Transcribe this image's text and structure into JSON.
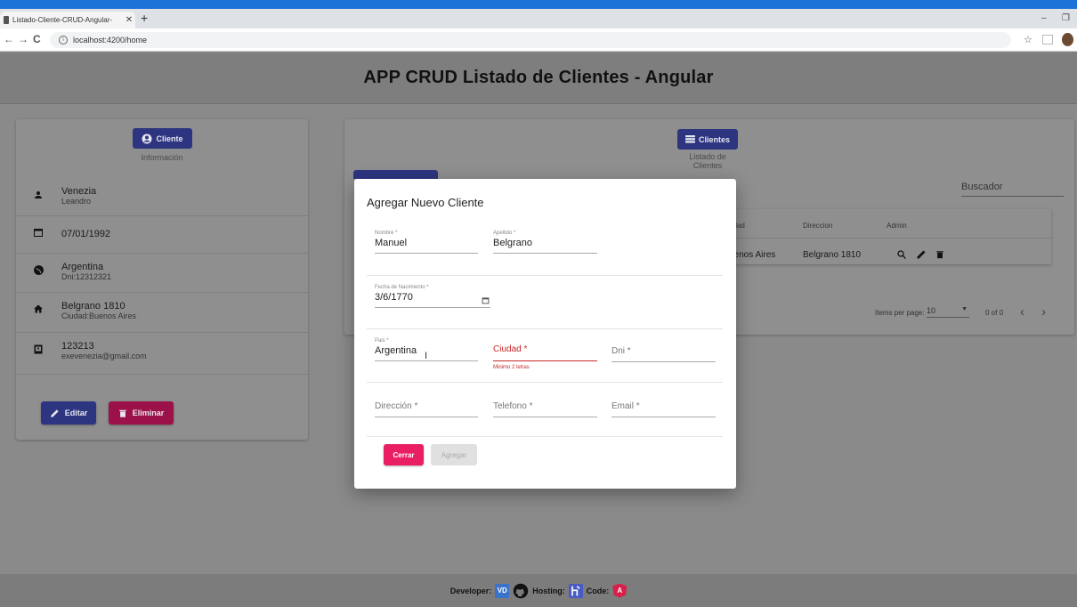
{
  "browser": {
    "tab_title": "Listado-Cliente-CRUD-Angular-",
    "tab_close": "✕",
    "new_tab": "+",
    "url": "localhost:4200/home",
    "back": "←",
    "forward": "→",
    "reload": "C",
    "minimize": "–",
    "restore": "❐"
  },
  "header": {
    "title": "APP CRUD Listado de Clientes - Angular"
  },
  "client_card": {
    "chip_label": "Cliente",
    "chip_caption": "Información",
    "rows": [
      {
        "icon": "person-icon",
        "line1": "Venezia",
        "line2": "Leandro"
      },
      {
        "icon": "calendar-icon",
        "line1": "07/01/1992",
        "line2": ""
      },
      {
        "icon": "globe-icon",
        "line1": "Argentina",
        "line2": "Dni:12312321"
      },
      {
        "icon": "home-icon",
        "line1": "Belgrano 1810",
        "line2": "Ciudad:Buenos Aires"
      },
      {
        "icon": "contact-card-icon",
        "line1": "123213",
        "line2": "exevenezia@gmail.com"
      }
    ],
    "edit_label": "Editar",
    "delete_label": "Eliminar"
  },
  "clients_card": {
    "chip_label": "Clientes",
    "chip_caption": "Listado de Clientes",
    "search_placeholder": "Buscador",
    "columns": [
      "udad",
      "Direccion",
      "Admin"
    ],
    "row": {
      "ciudad": "uenos Aires",
      "direccion": "Belgrano 1810"
    },
    "paginator": {
      "items_per_page_label": "Items per page:",
      "page_size": "10",
      "range": "0 of 0",
      "prev": "‹",
      "next": "›"
    }
  },
  "dialog": {
    "title": "Agregar Nuevo Cliente",
    "nombre": {
      "label": "Nombre *",
      "value": "Manuel"
    },
    "apellido": {
      "label": "Apellido *",
      "value": "Belgrano"
    },
    "fecha": {
      "label": "Fecha de Nacimiento *",
      "value": "3/6/1770"
    },
    "pais": {
      "label": "Pais *",
      "value": "Argentina"
    },
    "ciudad": {
      "placeholder": "Ciudad *",
      "error": "Minimo 2 letras"
    },
    "dni": {
      "placeholder": "Dni *"
    },
    "direccion": {
      "placeholder": "Dirección *"
    },
    "telefono": {
      "placeholder": "Telefono *"
    },
    "email": {
      "placeholder": "Email *"
    },
    "close_label": "Cerrar",
    "add_label": "Agregar"
  },
  "footer": {
    "developer_label": "Developer:",
    "hosting_label": "Hosting:",
    "code_label": "Code:",
    "vd_badge": "VD",
    "angular_badge": "A"
  },
  "colors": {
    "primary": "#2d3580",
    "warn": "#9c1149",
    "accent": "#e91e63",
    "error": "#c62828"
  }
}
